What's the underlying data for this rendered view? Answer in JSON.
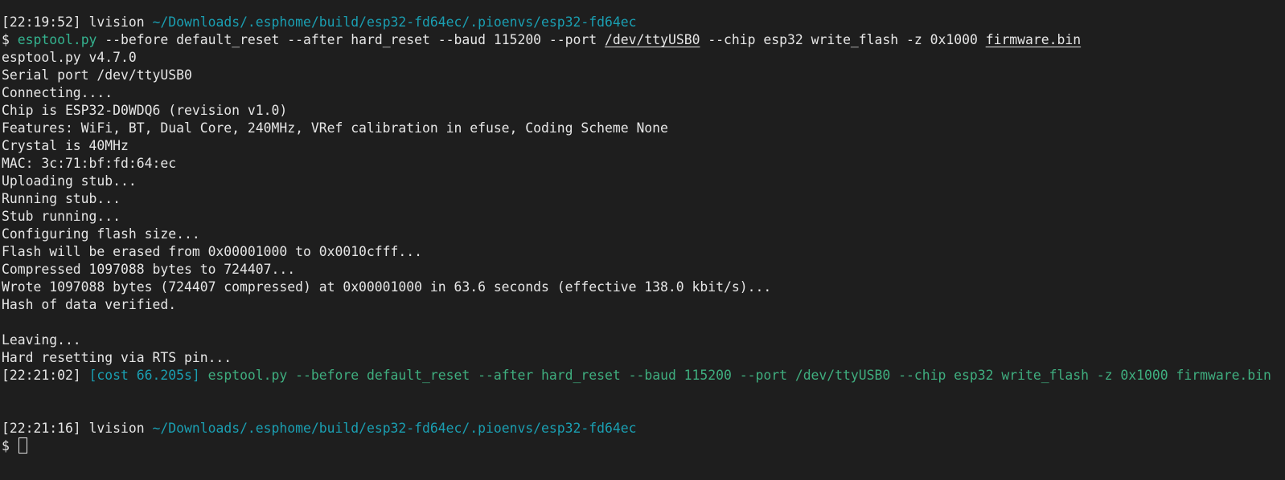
{
  "prompt1": {
    "timestamp": "[22:19:52]",
    "user": "lvision",
    "path": "~/Downloads/.esphome/build/esp32-fd64ec/.pioenvs/esp32-fd64ec"
  },
  "command": {
    "prompt_symbol": "$",
    "program": "esptool.py",
    "args_part1": "--before default_reset --after hard_reset --baud 115200 --port",
    "port": "/dev/ttyUSB0",
    "args_part2": "--chip esp32 write_flash -z 0x1000",
    "file": "firmware.bin"
  },
  "output_lines": [
    "esptool.py v4.7.0",
    "Serial port /dev/ttyUSB0",
    "Connecting....",
    "Chip is ESP32-D0WDQ6 (revision v1.0)",
    "Features: WiFi, BT, Dual Core, 240MHz, VRef calibration in efuse, Coding Scheme None",
    "Crystal is 40MHz",
    "MAC: 3c:71:bf:fd:64:ec",
    "Uploading stub...",
    "Running stub...",
    "Stub running...",
    "Configuring flash size...",
    "Flash will be erased from 0x00001000 to 0x0010cfff...",
    "Compressed 1097088 bytes to 724407...",
    "Wrote 1097088 bytes (724407 compressed) at 0x00001000 in 63.6 seconds (effective 138.0 kbit/s)...",
    "Hash of data verified.",
    "",
    "Leaving...",
    "Hard resetting via RTS pin..."
  ],
  "cost_line": {
    "timestamp": "[22:21:02]",
    "cost": "[cost 66.205s]",
    "command": "esptool.py --before default_reset --after hard_reset --baud 115200 --port /dev/ttyUSB0 --chip esp32 write_flash -z 0x1000 firmware.bin"
  },
  "prompt2": {
    "timestamp": "[22:21:16]",
    "user": "lvision",
    "path": "~/Downloads/.esphome/build/esp32-fd64ec/.pioenvs/esp32-fd64ec"
  },
  "input_prompt": {
    "prompt_symbol": "$"
  },
  "colors": {
    "background": "#1e1e1e",
    "foreground": "#e6e6e6",
    "path": "#1a9fb2",
    "program": "#34b38f",
    "cost_line": "#3fae7f"
  }
}
